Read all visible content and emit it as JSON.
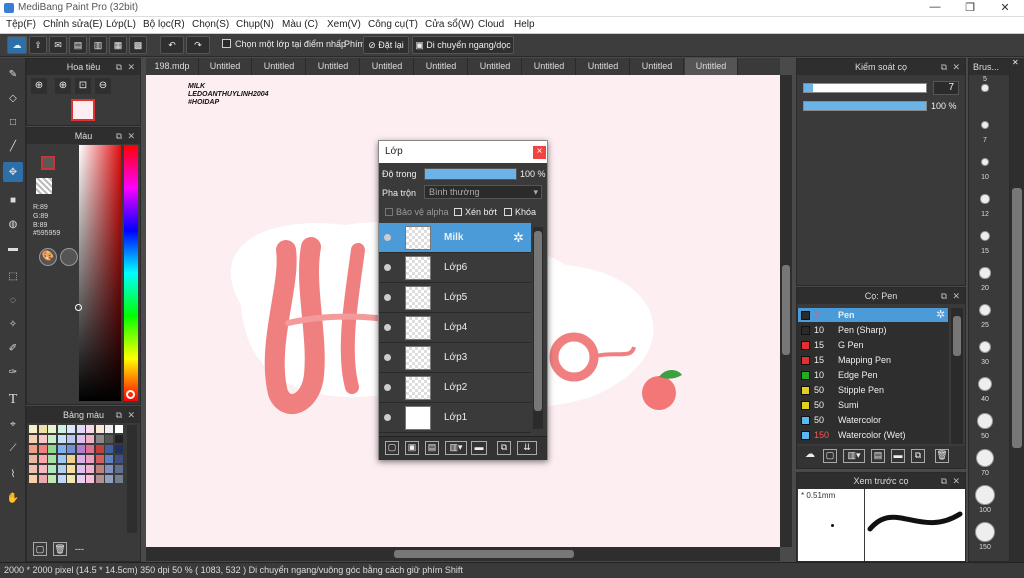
{
  "window": {
    "title": "MediBang Paint Pro (32bit)",
    "minimize": "—",
    "restore": "❐",
    "close": "✕"
  },
  "menu": [
    "Tệp(F)",
    "Chỉnh sửa(E)",
    "Lớp(L)",
    "Bộ lọc(R)",
    "Chọn(S)",
    "Chụp(N)",
    "Màu (C)",
    "Xem(V)",
    "Công cụ(T)",
    "Cửa sổ(W)",
    "Cloud",
    "Help"
  ],
  "toolbar": {
    "checkbox_label": "Chọn một lớp tại điểm nhấp",
    "key_label": "Phím",
    "reset_label": "Đặt lại",
    "move_label": "Di chuyển ngang/dọc"
  },
  "tabs": [
    "198.mdp",
    "Untitled",
    "Untitled",
    "Untitled",
    "Untitled",
    "Untitled",
    "Untitled",
    "Untitled",
    "Untitled",
    "Untitled",
    "Untitled"
  ],
  "navigator": {
    "title": "Hoa tiêu"
  },
  "color": {
    "title": "Màu",
    "r": "R:89",
    "g": "G:89",
    "b": "B:89",
    "hex": "#595959"
  },
  "palette": {
    "title": "Bảng màu",
    "footer": "---"
  },
  "canvas_text": {
    "line1": "MILK",
    "line2": "LEDOANTHUYLINH2004",
    "line3": "#HOIDAP"
  },
  "layer_panel": {
    "title": "Lớp",
    "close": "×",
    "opacity_label": "Độ trong",
    "opacity_value": "100 %",
    "opacity_fraction": 1.0,
    "blend_label": "Pha trộn",
    "blend_value": "Bình thường",
    "protect_alpha": "Bảo vệ alpha",
    "clip": "Xén bớt",
    "lock": "Khóa",
    "layers": [
      "Milk",
      "Lớp6",
      "Lớp5",
      "Lớp4",
      "Lớp3",
      "Lớp2",
      "Lớp1"
    ]
  },
  "brush_control": {
    "title": "Kiểm soát cọ",
    "size_value": "7",
    "opacity_value": "100 %",
    "size_fraction": 0.07,
    "opacity_fraction": 1.0
  },
  "brush_list": {
    "title": "Cọ: Pen",
    "items": [
      {
        "size": "7",
        "name": "Pen",
        "color": "#2b2b2b"
      },
      {
        "size": "10",
        "name": "Pen (Sharp)",
        "color": "#2b2b2b"
      },
      {
        "size": "15",
        "name": "G Pen",
        "color": "#e03030"
      },
      {
        "size": "15",
        "name": "Mapping Pen",
        "color": "#e03030"
      },
      {
        "size": "10",
        "name": "Edge Pen",
        "color": "#22aa22"
      },
      {
        "size": "50",
        "name": "Stipple Pen",
        "color": "#e0d020"
      },
      {
        "size": "50",
        "name": "Sumi",
        "color": "#e0d020"
      },
      {
        "size": "50",
        "name": "Watercolor",
        "color": "#5ab8f0"
      },
      {
        "size": "150",
        "name": "Watercolor (Wet)",
        "color": "#5ab8f0"
      }
    ]
  },
  "brush_preview": {
    "title": "Xem trước cọ",
    "size_label": "* 0.51mm"
  },
  "brush_sizes": {
    "title": "Brus...",
    "values": [
      "5",
      "7",
      "10",
      "12",
      "15",
      "20",
      "25",
      "30",
      "40",
      "50",
      "70",
      "100",
      "150"
    ]
  },
  "status": {
    "text": "2000 * 2000 pixel  (14.5 * 14.5cm)  350 dpi  50 %  ( 1083, 532 )  Di chuyển ngang/vuông góc bằng cách giữ phím Shift"
  }
}
